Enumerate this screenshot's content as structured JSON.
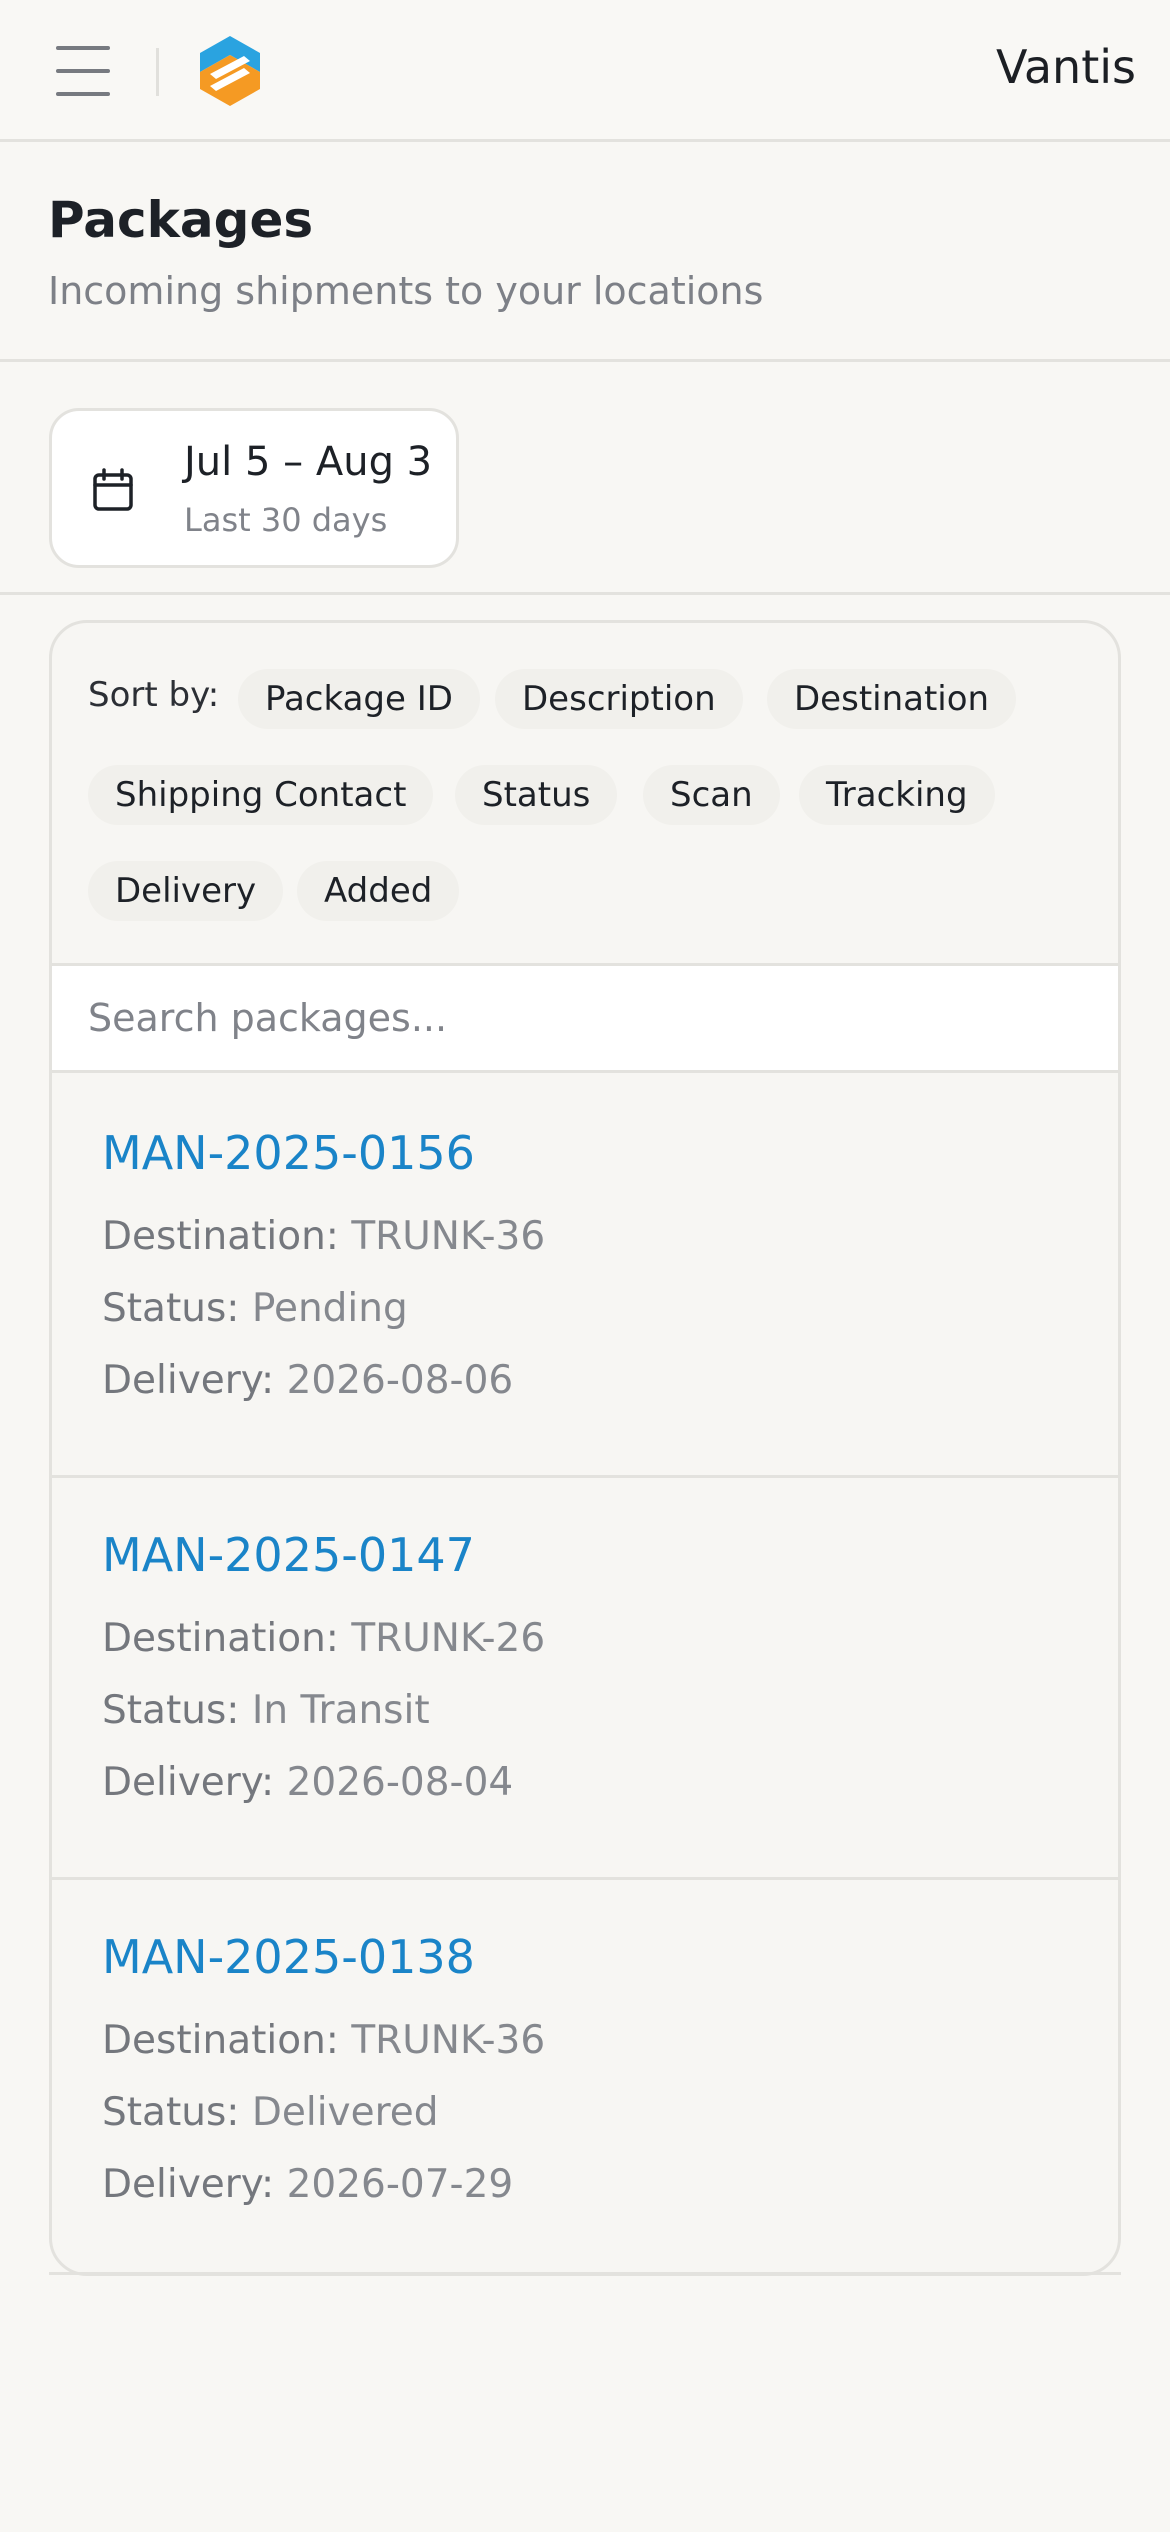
{
  "header": {
    "brand": "Vantis",
    "menu_icon": "hamburger-menu-icon",
    "logo_icon": "vantis-logo-icon",
    "colors": {
      "logo_blue": "#2aa3e0",
      "logo_orange": "#f59a23"
    }
  },
  "page": {
    "title": "Packages",
    "subtitle": "Incoming shipments to your locations"
  },
  "date_filter": {
    "icon": "calendar-icon",
    "range": "Jul 5 – Aug 3",
    "hint": "Last 30 days"
  },
  "sort": {
    "label": "Sort by:",
    "options": [
      "Package ID",
      "Description",
      "Destination",
      "Shipping Contact",
      "Status",
      "Scan",
      "Tracking",
      "Delivery",
      "Added"
    ]
  },
  "search": {
    "placeholder": "Search packages...",
    "value": ""
  },
  "labels": {
    "destination": "Destination:",
    "status": "Status:",
    "delivery": "Delivery:"
  },
  "packages": [
    {
      "id": "MAN-2025-0156",
      "destination": "TRUNK-36",
      "status": "Pending",
      "delivery": "2026-08-06"
    },
    {
      "id": "MAN-2025-0147",
      "destination": "TRUNK-26",
      "status": "In Transit",
      "delivery": "2026-08-04"
    },
    {
      "id": "MAN-2025-0138",
      "destination": "TRUNK-36",
      "status": "Delivered",
      "delivery": "2026-07-29"
    }
  ],
  "accent_color": "#1a84c8"
}
